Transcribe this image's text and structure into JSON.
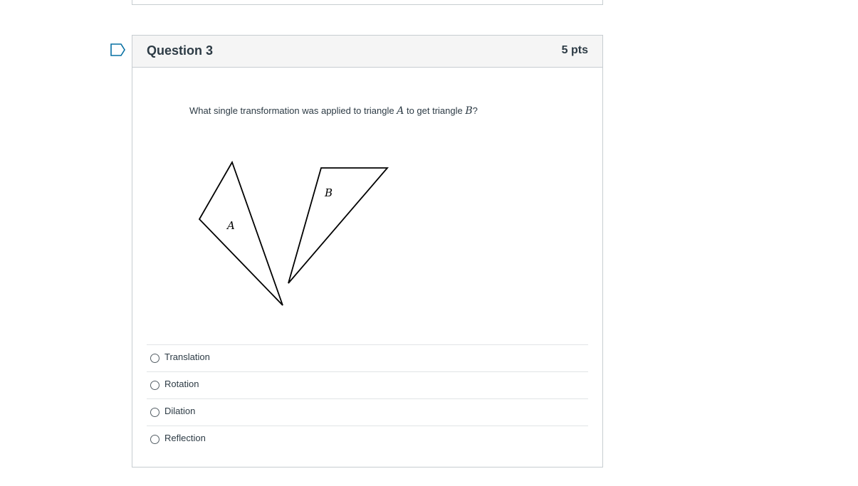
{
  "question": {
    "title": "Question 3",
    "points": "5 pts",
    "text_before": "What single transformation was applied to triangle ",
    "var_a": "A",
    "text_middle": " to get triangle ",
    "var_b": "B",
    "text_after": "?"
  },
  "diagram": {
    "label_a": "A",
    "label_b": "B"
  },
  "answers": [
    {
      "label": "Translation",
      "selected": false
    },
    {
      "label": "Rotation",
      "selected": false
    },
    {
      "label": "Dilation",
      "selected": false
    },
    {
      "label": "Reflection",
      "selected": false
    }
  ],
  "colors": {
    "header_bg": "#f5f5f5",
    "border": "#c7cdd1",
    "text": "#2d3b45",
    "flag": "#0770a3"
  },
  "icons": {
    "flag": "flag-question-icon"
  }
}
